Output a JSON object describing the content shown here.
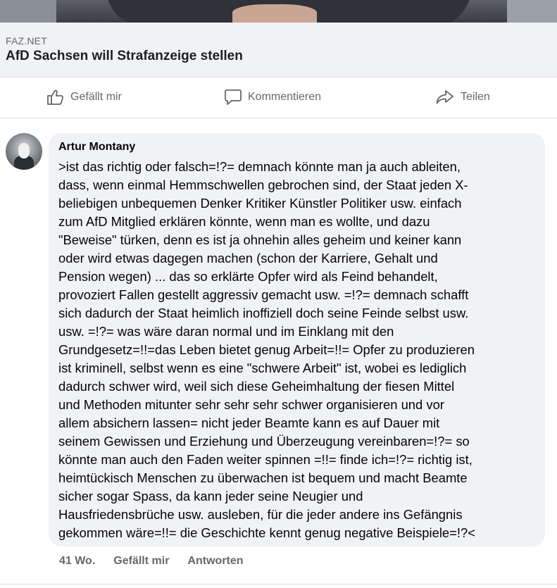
{
  "link": {
    "source": "FAZ.NET",
    "title": "AfD Sachsen will Strafanzeige stellen"
  },
  "actions": {
    "like_label": "Gefällt mir",
    "comment_label": "Kommentieren",
    "share_label": "Teilen"
  },
  "comment": {
    "author": "Artur Montany",
    "text": ">ist das richtig oder falsch=!?= demnach könnte man ja auch ableiten,\ndass, wenn einmal Hemmschwellen gebrochen sind, der Staat jeden X-\nbeliebigen unbequemen Denker Kritiker Künstler Politiker usw. einfach\nzum AfD Mitglied erklären könnte, wenn man es wollte, und dazu\n\"Beweise\" türken, denn es ist ja ohnehin alles geheim und keiner kann\noder wird etwas dagegen machen (schon der Karriere, Gehalt und\nPension wegen)  ... das so erklärte Opfer wird  als Feind behandelt,\nprovoziert Fallen gestellt aggressiv gemacht usw. =!?= demnach schafft\nsich dadurch der Staat heimlich inoffiziell doch  seine Feinde selbst usw.\nusw. =!?= was wäre daran normal und im Einklang mit den\nGrundgesetz=!!=das Leben bietet genug Arbeit=!!=  Opfer zu produzieren\nist kriminell, selbst wenn es eine \"schwere Arbeit\" ist, wobei es lediglich\ndadurch schwer wird, weil sich diese  Geheimhaltung der fiesen Mittel\nund Methoden mitunter sehr sehr sehr schwer organisieren und vor\nallem absichern lassen= nicht jeder Beamte kann es auf Dauer mit\nseinem Gewissen und Erziehung und Überzeugung vereinbaren=!?= so\nkönnte man auch den Faden weiter spinnen =!!= finde ich=!?= richtig ist,\nheimtückisch Menschen zu überwachen ist bequem und macht Beamte\nsicher sogar Spass, da kann jeder seine Neugier und\nHausfriedensbrüche usw.  ausleben, für die jeder andere ins Gefängnis\ngekommen wäre=!!= die Geschichte kennt genug negative Beispiele=!?<",
    "age": "41 Wo.",
    "like_label": "Gefällt mir",
    "reply_label": "Antworten"
  },
  "icons": {
    "like": "thumbs-up-icon",
    "comment": "speech-bubble-icon",
    "share": "share-arrow-icon"
  },
  "colors": {
    "secondary_text": "#65676b",
    "bubble_bg": "#f0f2f5",
    "divider": "#dadde1"
  }
}
